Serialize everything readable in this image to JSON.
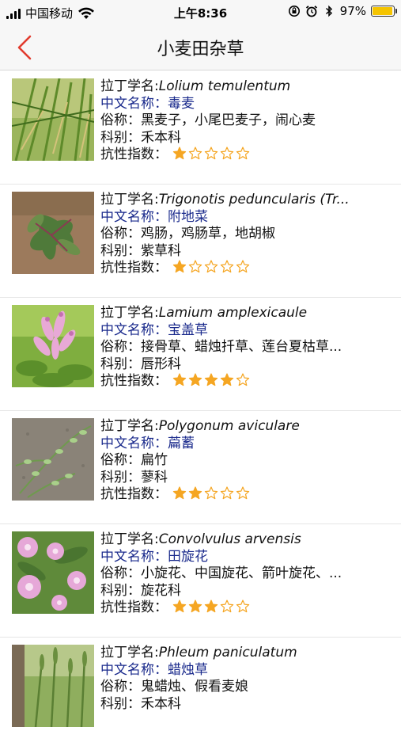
{
  "status_bar": {
    "carrier": "中国移动",
    "time": "上午8:36",
    "battery": "97%",
    "battery_level": 0.97
  },
  "nav": {
    "title": "小麦田杂草",
    "back_icon": "chevron-left-icon",
    "accent_color": "#e23b2e"
  },
  "labels": {
    "latin": "拉丁学名:",
    "chinese": "中文名称：",
    "common": "俗称：",
    "family": "科别：",
    "resistance": "抗性指数："
  },
  "star_color": "#f5a623",
  "items": [
    {
      "latin": "Lolium temulentum",
      "chinese": "毒麦",
      "common": "黑麦子，小尾巴麦子，闹心麦",
      "family": "禾本科",
      "rating": 1
    },
    {
      "latin": "Trigonotis peduncularis (Tr...",
      "chinese": "附地菜",
      "common": "鸡肠，鸡肠草，地胡椒",
      "family": "紫草科",
      "rating": 1
    },
    {
      "latin": "Lamium amplexicaule",
      "chinese": "宝盖草",
      "common": "接骨草、蜡烛扦草、莲台夏枯草...",
      "family": "唇形科",
      "rating": 4
    },
    {
      "latin": "Polygonum aviculare",
      "chinese": "萹蓄",
      "common": "扁竹",
      "family": "蓼科",
      "rating": 2
    },
    {
      "latin": "Convolvulus arvensis",
      "chinese": "田旋花",
      "common": "小旋花、中国旋花、箭叶旋花、...",
      "family": "旋花科",
      "rating": 3
    },
    {
      "latin": "Phleum paniculatum",
      "chinese": "蜡烛草",
      "common": "鬼蜡烛、假看麦娘",
      "family": "禾本科",
      "rating": null
    }
  ]
}
